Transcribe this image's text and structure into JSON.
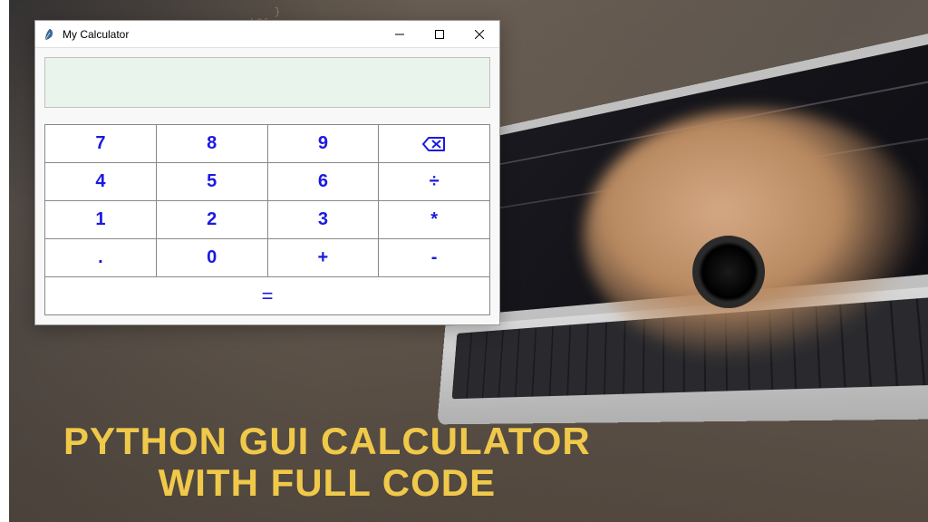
{
  "window": {
    "title": "My Calculator",
    "display_value": ""
  },
  "buttons": {
    "r0c0": "7",
    "r0c1": "8",
    "r0c2": "9",
    "r1c0": "4",
    "r1c1": "5",
    "r1c2": "6",
    "r1c3": "÷",
    "r2c0": "1",
    "r2c1": "2",
    "r2c2": "3",
    "r2c3": "*",
    "r3c0": ".",
    "r3c1": "0",
    "r3c2": "+",
    "r3c3": "-",
    "equals": "="
  },
  "caption": {
    "line1": "PYTHON GUI CALCULATOR",
    "line2": "WITH FULL CODE"
  },
  "colors": {
    "button_text": "#1a1ae0",
    "display_bg": "#e8f4ec",
    "caption_color": "#f0c94a"
  }
}
